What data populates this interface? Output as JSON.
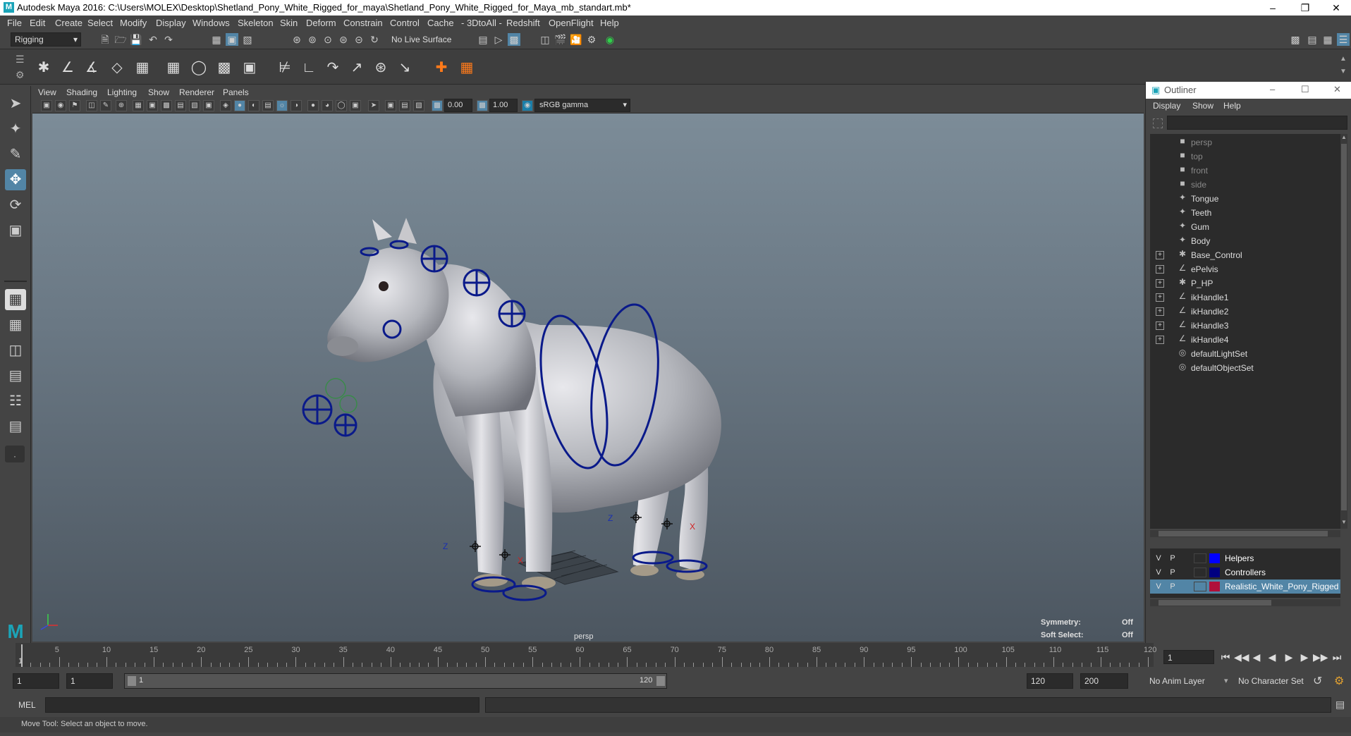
{
  "window": {
    "title": "Autodesk Maya 2016: C:\\Users\\MOLEX\\Desktop\\Shetland_Pony_White_Rigged_for_maya\\Shetland_Pony_White_Rigged_for_Maya_mb_standart.mb*"
  },
  "menubar": [
    "File",
    "Edit",
    "Create",
    "Select",
    "Modify",
    "Display",
    "Windows",
    "Skeleton",
    "Skin",
    "Deform",
    "Constrain",
    "Control",
    "Cache",
    "- 3DtoAll -",
    "Redshift",
    "OpenFlight",
    "Help"
  ],
  "statusline": {
    "menuset": "Rigging",
    "live_surface": "No Live Surface"
  },
  "panel": {
    "menus": [
      "View",
      "Shading",
      "Lighting",
      "Show",
      "Renderer",
      "Panels"
    ],
    "exposure": "0.00",
    "gamma": "1.00",
    "colorspace": "sRGB gamma",
    "camera": "persp",
    "symmetry_label": "Symmetry:",
    "symmetry_value": "Off",
    "softselect_label": "Soft Select:",
    "softselect_value": "Off"
  },
  "outliner": {
    "title": "Outliner",
    "menus": [
      "Display",
      "Show",
      "Help"
    ],
    "items": [
      {
        "label": "persp",
        "icon": "camera-icon",
        "expandable": false,
        "dim": true
      },
      {
        "label": "top",
        "icon": "camera-icon",
        "expandable": false,
        "dim": true
      },
      {
        "label": "front",
        "icon": "camera-icon",
        "expandable": false,
        "dim": true
      },
      {
        "label": "side",
        "icon": "camera-icon",
        "expandable": false,
        "dim": true
      },
      {
        "label": "Tongue",
        "icon": "mesh-icon",
        "expandable": false,
        "dim": false
      },
      {
        "label": "Teeth",
        "icon": "mesh-icon",
        "expandable": false,
        "dim": false
      },
      {
        "label": "Gum",
        "icon": "mesh-icon",
        "expandable": false,
        "dim": false
      },
      {
        "label": "Body",
        "icon": "mesh-icon",
        "expandable": false,
        "dim": false
      },
      {
        "label": "Base_Control",
        "icon": "joint-icon",
        "expandable": true,
        "dim": false
      },
      {
        "label": "ePelvis",
        "icon": "ik-icon",
        "expandable": true,
        "dim": false
      },
      {
        "label": "P_HP",
        "icon": "joint-icon",
        "expandable": true,
        "dim": false
      },
      {
        "label": "ikHandle1",
        "icon": "ik-icon",
        "expandable": true,
        "dim": false
      },
      {
        "label": "ikHandle2",
        "icon": "ik-icon",
        "expandable": true,
        "dim": false
      },
      {
        "label": "ikHandle3",
        "icon": "ik-icon",
        "expandable": true,
        "dim": false
      },
      {
        "label": "ikHandle4",
        "icon": "ik-icon",
        "expandable": true,
        "dim": false
      },
      {
        "label": "defaultLightSet",
        "icon": "set-icon",
        "expandable": false,
        "dim": false
      },
      {
        "label": "defaultObjectSet",
        "icon": "set-icon",
        "expandable": false,
        "dim": false
      }
    ]
  },
  "layers": [
    {
      "v": "V",
      "p": "P",
      "name": "Helpers",
      "color": "#0000ff",
      "selected": false
    },
    {
      "v": "V",
      "p": "P",
      "name": "Controllers",
      "color": "#000080",
      "selected": false
    },
    {
      "v": "V",
      "p": "P",
      "name": "Realistic_White_Pony_Rigged",
      "color": "#b0103a",
      "selected": true
    }
  ],
  "timeline": {
    "ticks": [
      "5",
      "10",
      "15",
      "20",
      "25",
      "30",
      "35",
      "40",
      "45",
      "50",
      "55",
      "60",
      "65",
      "70",
      "75",
      "80",
      "85",
      "90",
      "95",
      "100",
      "105",
      "110",
      "115",
      "120"
    ],
    "start_label": "1",
    "current_frame": "1"
  },
  "range": {
    "start": "1",
    "playback_start": "1",
    "slider_start": "1",
    "slider_end": "120",
    "playback_end": "120",
    "end": "200",
    "anim_layer": "No Anim Layer",
    "character_set": "No Character Set"
  },
  "cmdline": {
    "label": "MEL"
  },
  "help": {
    "text": "Move Tool: Select an object to move."
  },
  "colors": {
    "controller": "#0a1a8a",
    "accent": "#5285a6"
  }
}
